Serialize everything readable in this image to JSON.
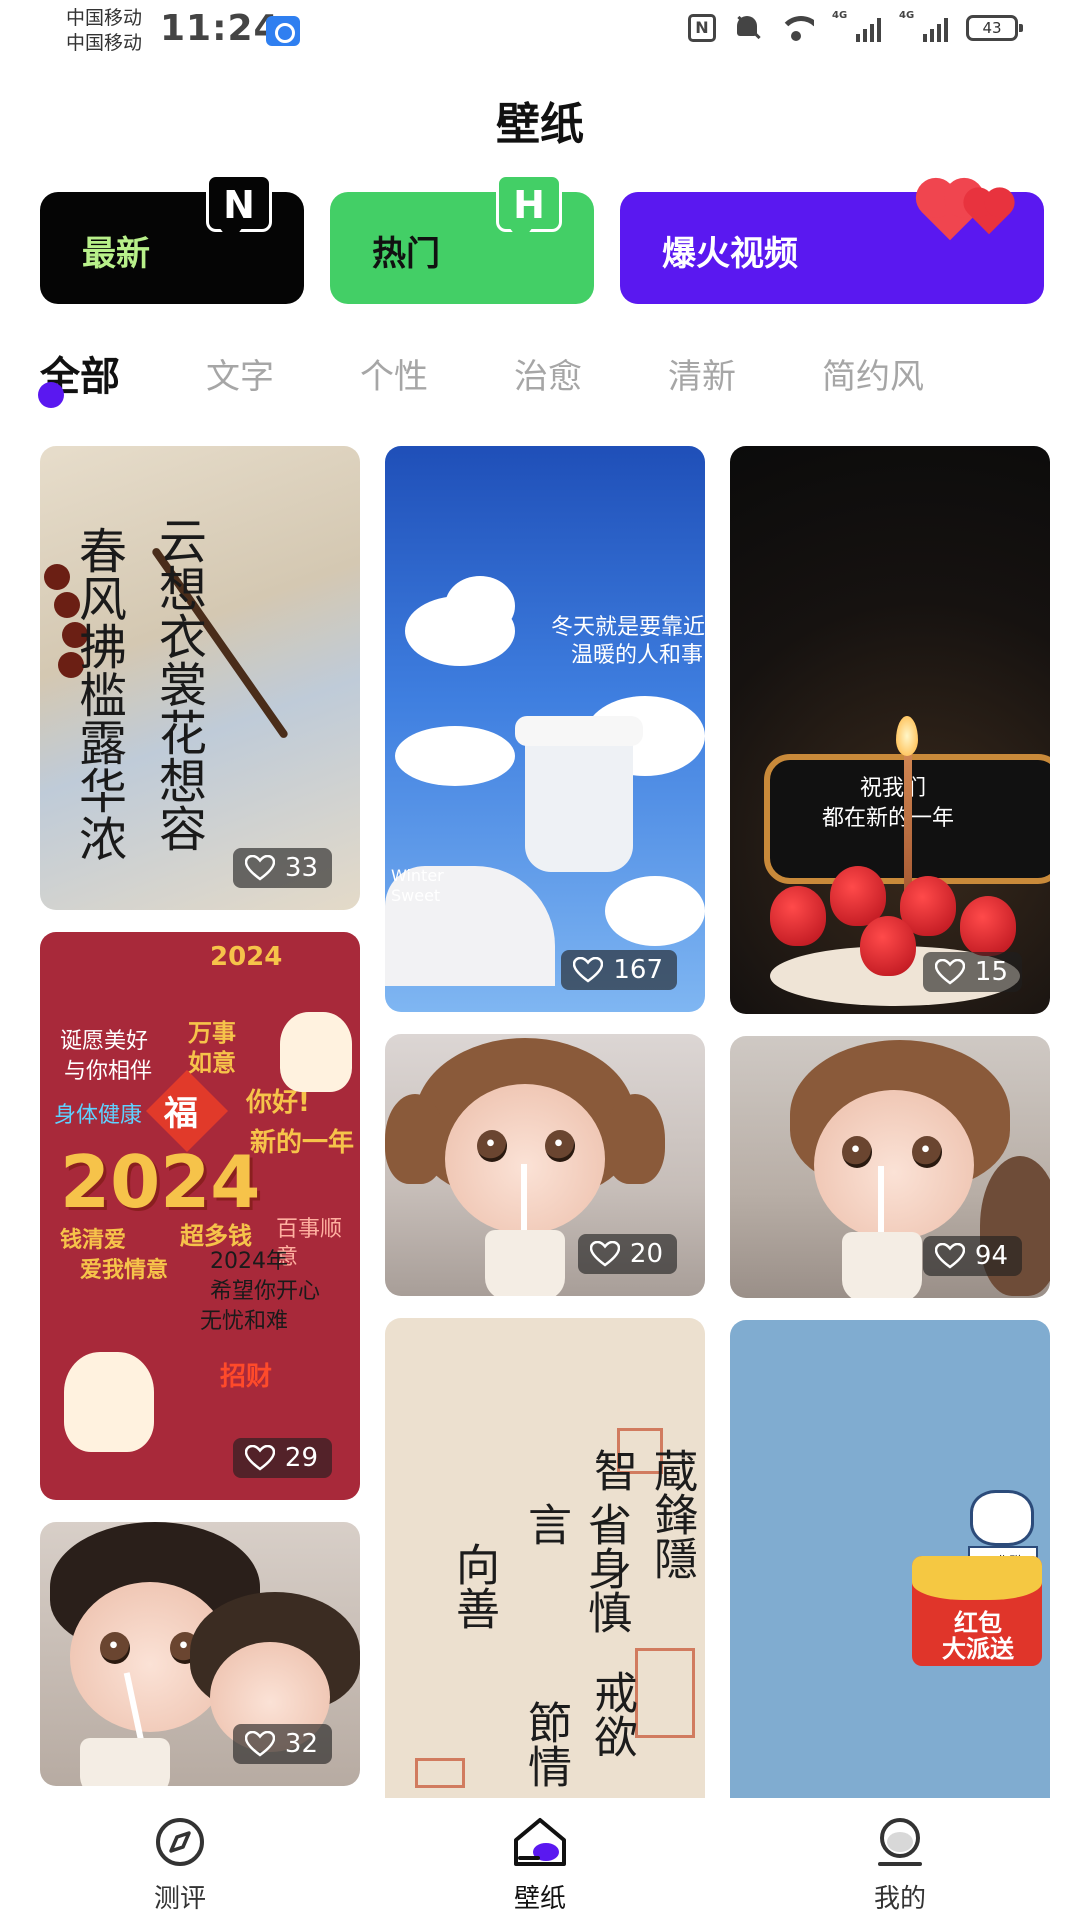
{
  "status_bar": {
    "carrier1": "中国移动",
    "carrier2": "中国移动",
    "time": "11:24",
    "nfc": "N",
    "net1": "4G",
    "net2": "4G",
    "battery": "43"
  },
  "header": {
    "title": "壁纸"
  },
  "categories": [
    {
      "label": "最新",
      "badge": "N",
      "color": "#050505"
    },
    {
      "label": "热门",
      "badge": "H",
      "color": "#43cf66"
    },
    {
      "label": "爆火视频",
      "badge_icon": "hearts-icon",
      "color": "#5a18f0"
    }
  ],
  "tabs": [
    {
      "label": "全部",
      "active": true
    },
    {
      "label": "文字"
    },
    {
      "label": "个性"
    },
    {
      "label": "治愈"
    },
    {
      "label": "清新"
    },
    {
      "label": "简约风"
    }
  ],
  "cards": {
    "calligraphy": {
      "likes": "33",
      "text1": "春风拂槛露华浓",
      "text2": "云想衣裳花想容"
    },
    "new_year": {
      "likes": "29",
      "year": "2024",
      "top": "2024",
      "wish1": "诞愿美好",
      "wish2": "与你相伴",
      "wish3": "万事如意",
      "wish4": "你好!",
      "wish5": "新的一年",
      "wish6": "身体健康",
      "fu": "福",
      "wish7": "超多钱",
      "wish8": "百事顺意",
      "wish9": "钱清爱",
      "wish10": "爱我情意",
      "wish11": "2024年",
      "wish12": "希望你开心",
      "wish13": "无忧和难",
      "wish14": "招财"
    },
    "kids_dark": {
      "likes": "32"
    },
    "sky_cup": {
      "likes": "167",
      "line1": "冬天就是要靠近",
      "line2": "温暖的人和事",
      "tag": "Winter Sweet"
    },
    "girl_drink": {
      "likes": "20"
    },
    "paper_quote": {
      "col1": "蔵鋒隱智",
      "col2": "省身慎言",
      "col3": "節情",
      "col4": "戒欲",
      "col5": "向善"
    },
    "cake": {
      "likes": "15",
      "line1": "祝我们",
      "line2": "都在新的一年"
    },
    "boy_drink": {
      "likes": "94"
    },
    "red_packet": {
      "sign": "工作群",
      "line1": "红包",
      "line2": "大派送"
    }
  },
  "bottom_nav": [
    {
      "label": "测评",
      "icon": "compass-icon"
    },
    {
      "label": "壁纸",
      "icon": "home-icon",
      "active": true
    },
    {
      "label": "我的",
      "icon": "profile-icon"
    }
  ],
  "colors": {
    "accent": "#5a18f0",
    "green": "#43cf66",
    "black": "#050505",
    "muted_tab": "#a6a6a6"
  }
}
